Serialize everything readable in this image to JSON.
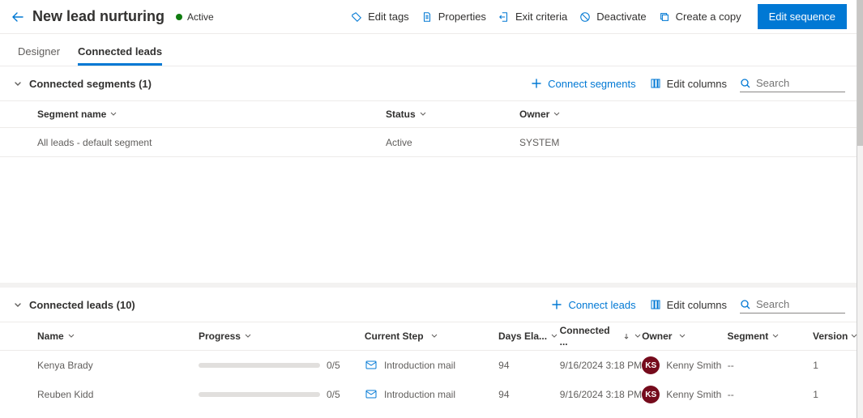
{
  "header": {
    "title": "New lead nurturing",
    "status": "Active",
    "commands": {
      "edit_tags": "Edit tags",
      "properties": "Properties",
      "exit_criteria": "Exit criteria",
      "deactivate": "Deactivate",
      "create_copy": "Create a copy",
      "edit_sequence": "Edit sequence"
    }
  },
  "tabs": {
    "designer": "Designer",
    "connected_leads": "Connected leads"
  },
  "segments_section": {
    "title": "Connected segments (1)",
    "connect_label": "Connect segments",
    "edit_columns_label": "Edit columns",
    "search_placeholder": "Search",
    "columns": {
      "name": "Segment name",
      "status": "Status",
      "owner": "Owner"
    },
    "rows": [
      {
        "name": "All leads - default segment",
        "status": "Active",
        "owner": "SYSTEM"
      }
    ]
  },
  "leads_section": {
    "title": "Connected leads (10)",
    "connect_label": "Connect leads",
    "edit_columns_label": "Edit columns",
    "search_placeholder": "Search",
    "columns": {
      "name": "Name",
      "progress": "Progress",
      "current_step": "Current Step",
      "days_elapsed": "Days Ela...",
      "connected": "Connected ...",
      "owner": "Owner",
      "segment": "Segment",
      "version": "Version"
    },
    "rows": [
      {
        "name": "Kenya Brady",
        "progress": "0/5",
        "step": "Introduction mail",
        "days": "94",
        "connected": "9/16/2024 3:18 PM",
        "owner_initials": "KS",
        "owner": "Kenny Smith",
        "segment": "--",
        "version": "1"
      },
      {
        "name": "Reuben Kidd",
        "progress": "0/5",
        "step": "Introduction mail",
        "days": "94",
        "connected": "9/16/2024 3:18 PM",
        "owner_initials": "KS",
        "owner": "Kenny Smith",
        "segment": "--",
        "version": "1"
      }
    ]
  }
}
